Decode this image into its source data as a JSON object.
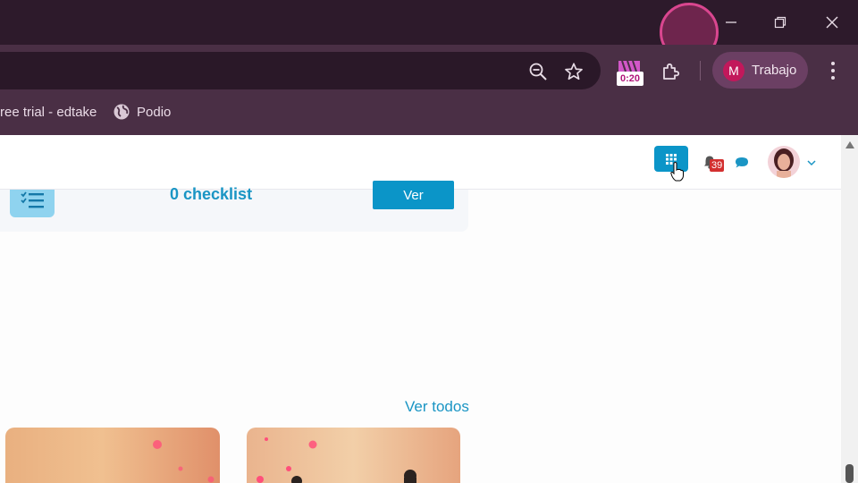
{
  "browser": {
    "profile_initial": "M",
    "profile_label": "Trabajo",
    "extension_timer": "0:20",
    "bookmarks": [
      {
        "label": "ree trial - edtake"
      },
      {
        "label": "Podio"
      }
    ]
  },
  "app": {
    "notification_count": "39",
    "checklist_text": "0 checklist",
    "ver_button": "Ver",
    "ver_todos": "Ver todos"
  },
  "colors": {
    "accent": "#0b95c8",
    "titlebar": "#2d1a2b",
    "toolbar": "#4a2f45",
    "badge": "#d32f2f"
  }
}
